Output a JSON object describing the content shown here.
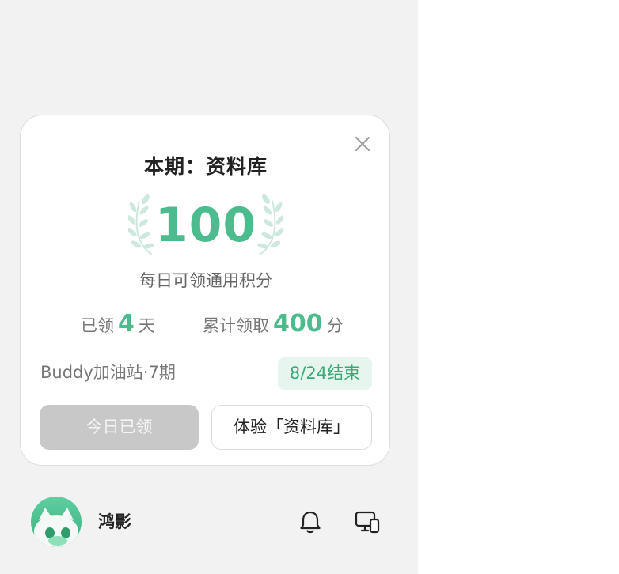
{
  "card": {
    "title": "本期：资料库",
    "points": "100",
    "points_desc": "每日可领通用积分",
    "stats": {
      "days_prefix": "已领",
      "days_value": "4",
      "days_suffix": "天",
      "total_prefix": "累计领取",
      "total_value": "400",
      "total_suffix": "分"
    },
    "event_name": "Buddy加油站·7期",
    "end_badge": "8/24结束",
    "claimed_button": "今日已领",
    "try_button": "体验「资料库」",
    "close_icon": "close-icon"
  },
  "footer": {
    "username": "鸿影",
    "bell_icon": "bell-icon",
    "device_icon": "device-switch-icon"
  },
  "colors": {
    "accent": "#4cbc8e",
    "badge_bg": "#e6f6ef",
    "disabled": "#c8c8c8",
    "panel_bg": "#f2f2f2"
  }
}
